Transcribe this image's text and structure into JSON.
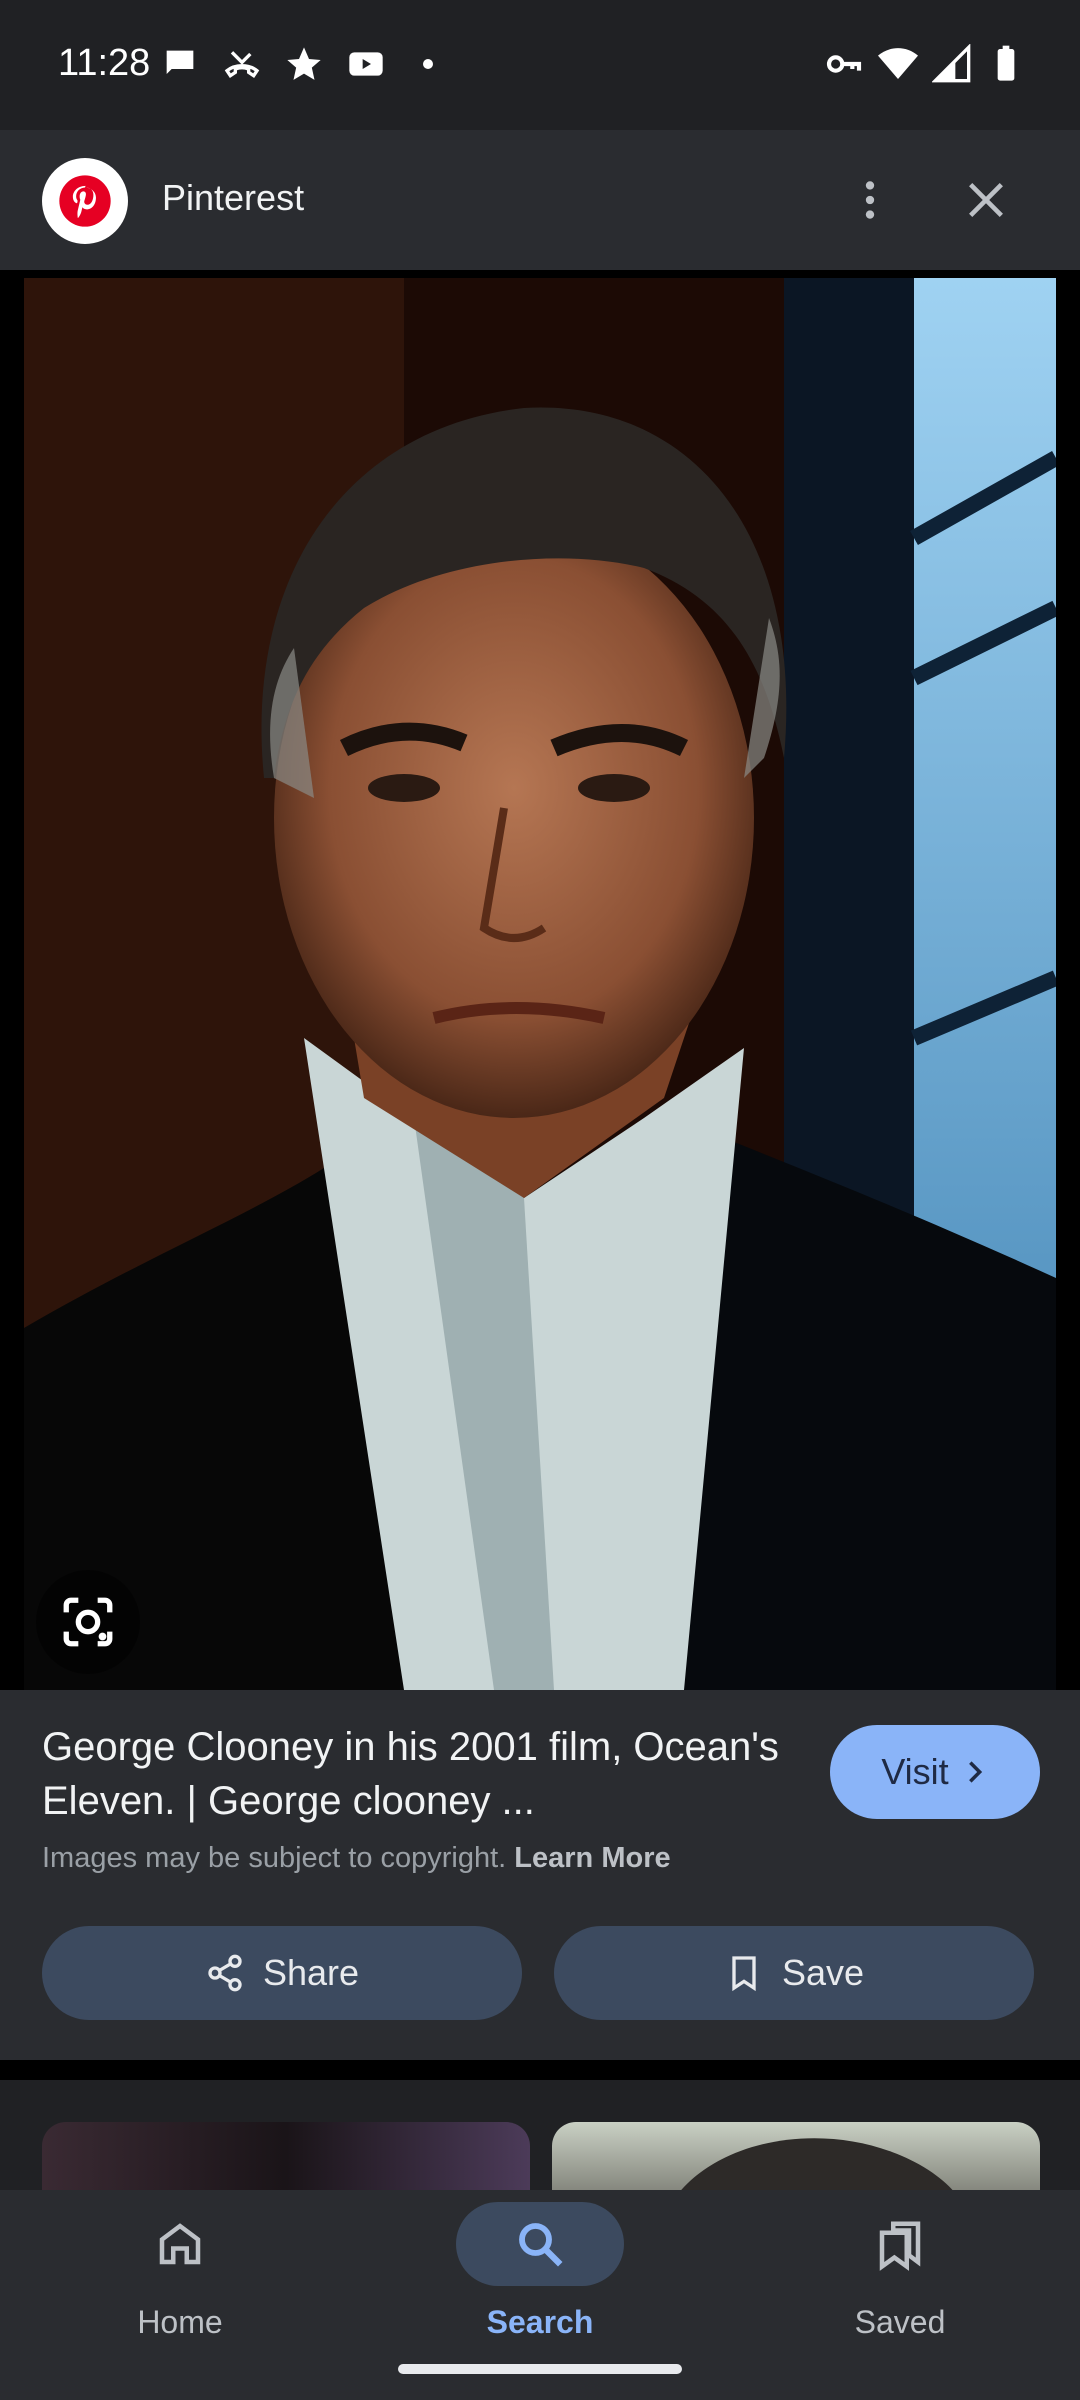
{
  "status_bar": {
    "time": "11:28",
    "left_icons": [
      "chat-bubble-icon",
      "missed-call-icon",
      "star-icon",
      "youtube-icon",
      "dot-icon"
    ],
    "right_icons": [
      "vpn-key-icon",
      "wifi-icon",
      "signal-icon",
      "battery-icon"
    ]
  },
  "source": {
    "name": "Pinterest",
    "logo_color": "#e60023"
  },
  "image": {
    "lens_icon": "google-lens-icon"
  },
  "info": {
    "title": "George Clooney in his 2001 film, Ocean's Eleven. | George clooney ...",
    "visit_label": "Visit",
    "copyright_text": "Images may be subject to copyright.",
    "learn_more_label": "Learn More",
    "share_label": "Share",
    "save_label": "Save"
  },
  "nav": {
    "items": [
      {
        "label": "Home",
        "icon": "home-icon"
      },
      {
        "label": "Search",
        "icon": "search-icon",
        "selected": true
      },
      {
        "label": "Saved",
        "icon": "saved-icon"
      }
    ]
  },
  "colors": {
    "accent": "#8ab4f8",
    "background": "#2a2c30",
    "button_bg": "#3c4a5f"
  }
}
